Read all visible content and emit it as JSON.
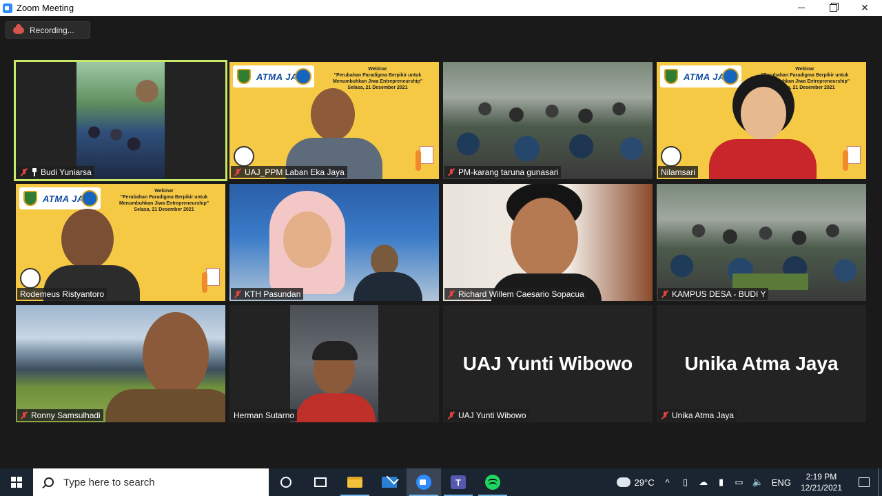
{
  "window": {
    "title": "Zoom Meeting"
  },
  "recording": {
    "label": "Recording..."
  },
  "banner": {
    "logo_word": "ATMA JAYA",
    "line1": "Webinar",
    "line2": "\"Perubahan Paradigma Berpikir untuk",
    "line3": "Menumbuhkan Jiwa Entrepreneurship\"",
    "line4": "Selasa, 21 Desember 2021"
  },
  "participants": [
    {
      "name": "Budi Yuniarsa",
      "muted": true,
      "pinned": true,
      "active": true
    },
    {
      "name": "UAJ_PPM Laban Eka Jaya",
      "muted": true
    },
    {
      "name": "PM-karang taruna gunasari",
      "muted": true
    },
    {
      "name": "Nilamsari",
      "muted": false
    },
    {
      "name": "Rodemeus Ristyantoro",
      "muted": false
    },
    {
      "name": "KTH Pasundan",
      "muted": true
    },
    {
      "name": "Richard Willem Caesario Sopacua",
      "muted": true
    },
    {
      "name": "KAMPUS DESA - BUDI Y",
      "muted": true
    },
    {
      "name": "Ronny Samsulhadi",
      "muted": true
    },
    {
      "name": "Herman Sutarno",
      "muted": false
    },
    {
      "name": "UAJ Yunti Wibowo",
      "muted": true,
      "big_label": "UAJ Yunti Wibowo"
    },
    {
      "name": "Unika Atma Jaya",
      "muted": true,
      "big_label": "Unika Atma Jaya"
    }
  ],
  "taskbar": {
    "search_placeholder": "Type here to search",
    "apps": [
      "cortana",
      "task-view",
      "file-explorer",
      "mail",
      "zoom",
      "teams",
      "spotify"
    ],
    "weather": "29°C",
    "language": "ENG",
    "time": "2:19 PM",
    "date": "12/21/2021"
  },
  "colors": {
    "active_speaker": "#c8e86a",
    "muted_mic": "#e0443e",
    "banner_yellow": "#f6c945",
    "taskbar": "#1b2532"
  }
}
